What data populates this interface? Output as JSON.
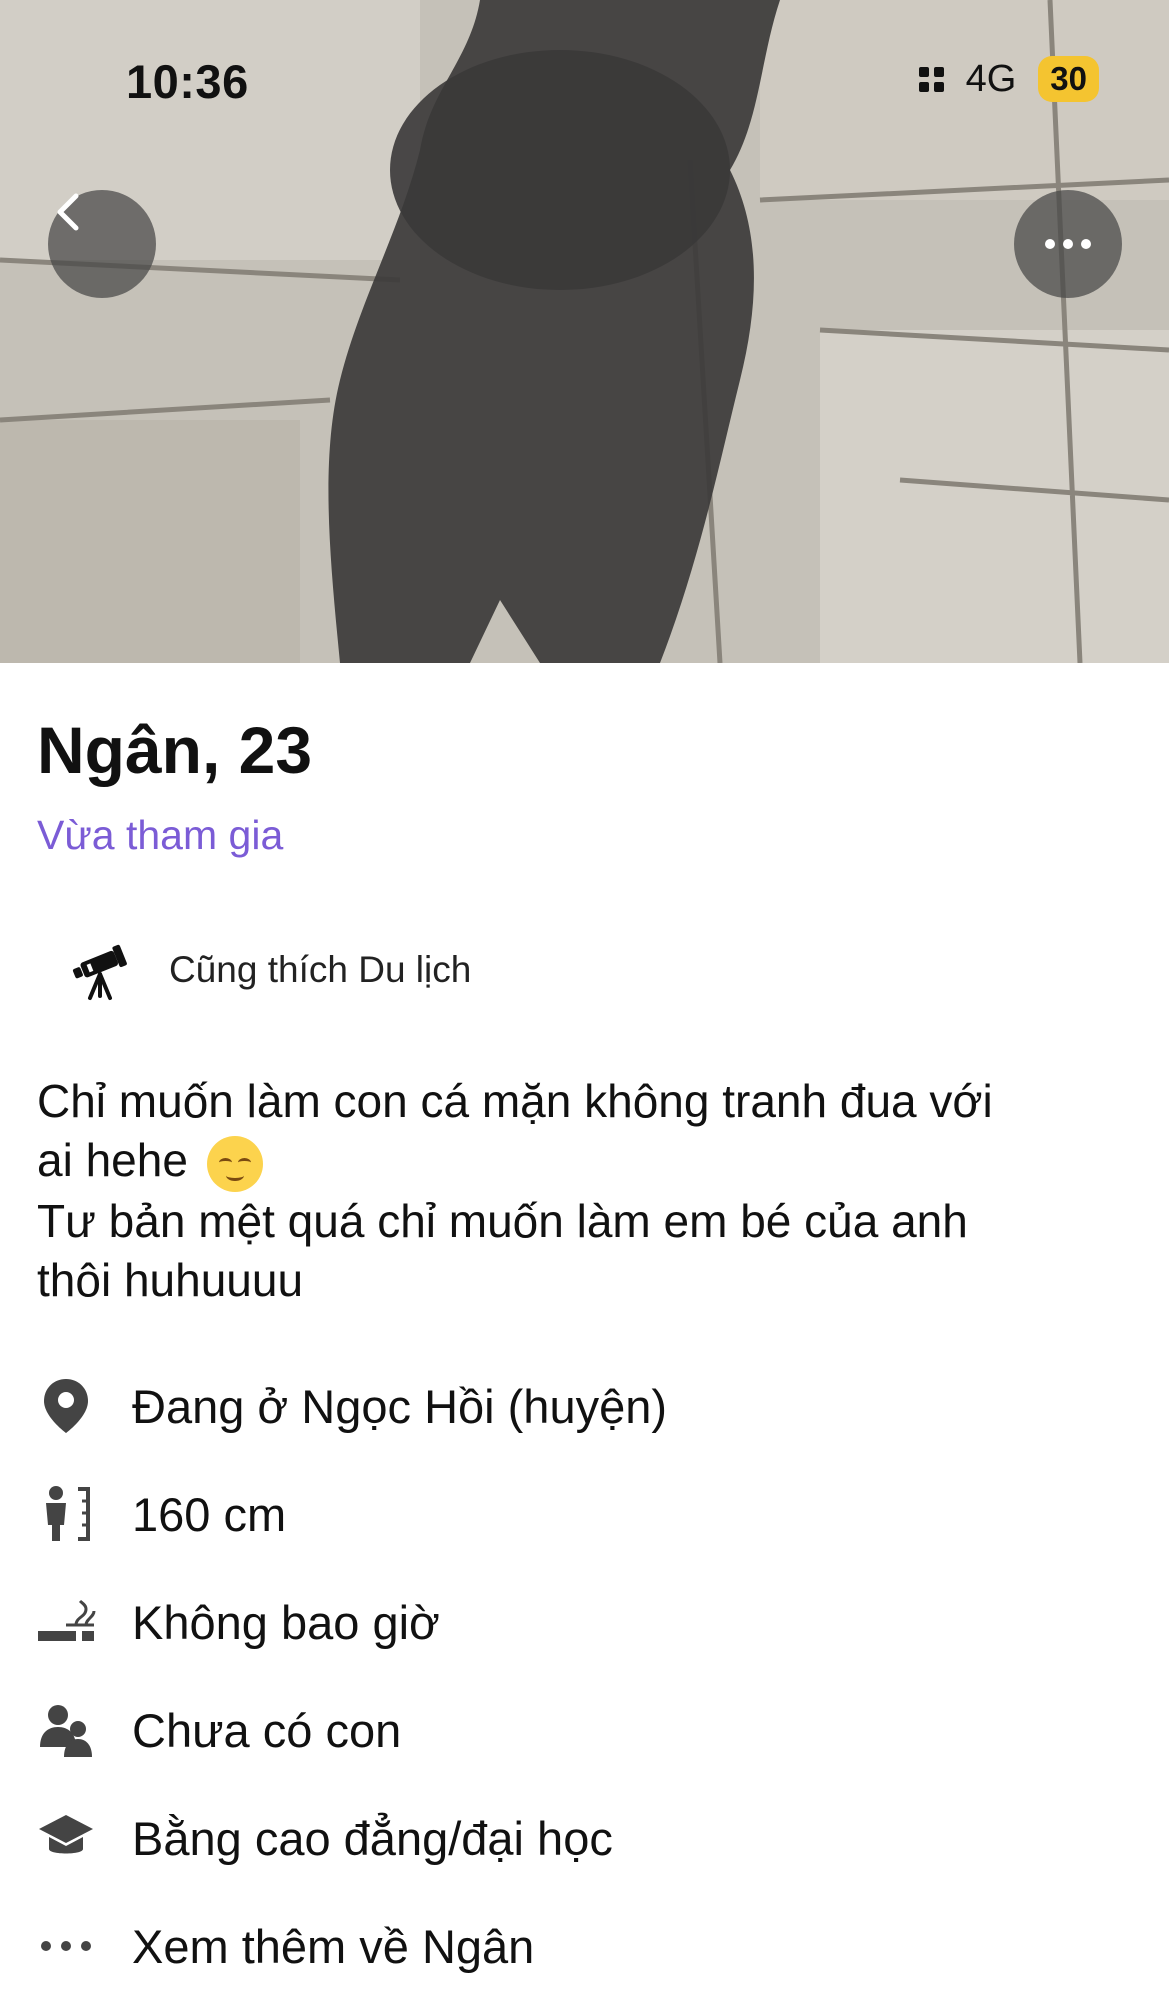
{
  "status_bar": {
    "time": "10:36",
    "network": "4G",
    "battery": "30"
  },
  "profile": {
    "name_age": "Ngân, 23",
    "joined_label": "Vừa tham gia",
    "shared_interest": {
      "icon": "telescope-icon",
      "label": "Cũng thích Du lịch"
    },
    "bio": {
      "line1": "Chỉ muốn làm con cá mặn không tranh đua với",
      "line2": "ai hehe",
      "line3": "Tư bản mệt quá chỉ muốn làm em bé của anh",
      "line4": "thôi huhuuuu"
    },
    "facts": [
      {
        "icon": "location-pin-icon",
        "label": "Đang ở Ngọc Hồi (huyện)"
      },
      {
        "icon": "height-icon",
        "label": "160 cm"
      },
      {
        "icon": "smoking-icon",
        "label": "Không bao giờ"
      },
      {
        "icon": "children-icon",
        "label": "Chưa có con"
      },
      {
        "icon": "education-icon",
        "label": "Bằng cao đẳng/đại học"
      },
      {
        "icon": "more-dots-icon",
        "label": "Xem thêm về Ngân"
      }
    ]
  },
  "colors": {
    "accent": "#7b5cd6",
    "text": "#111111",
    "overlay_button": "#464646"
  }
}
